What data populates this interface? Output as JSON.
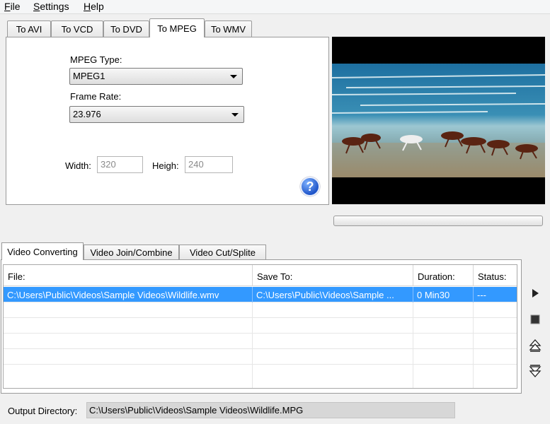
{
  "menu": {
    "items": [
      {
        "label": "File",
        "key": "F",
        "rest": "ile"
      },
      {
        "label": "Settings",
        "key": "S",
        "rest": "ettings"
      },
      {
        "label": "Help",
        "key": "H",
        "rest": "elp"
      }
    ]
  },
  "format_tabs": [
    "To AVI",
    "To  VCD",
    "To DVD",
    "To MPEG",
    "To WMV"
  ],
  "active_format_tab": "To MPEG",
  "mpeg": {
    "type_label": "MPEG Type:",
    "type_value": "MPEG1",
    "frame_rate_label": "Frame Rate:",
    "frame_rate_value": "23.976",
    "width_label": "Width:",
    "width_value": "320",
    "height_label": "Heigh:",
    "height_value": "240"
  },
  "help_icon": "question-icon",
  "preview": {
    "description_icon": "video-preview-image"
  },
  "bottom_tabs": [
    "Video Converting",
    "Video Join/Combine",
    "Video Cut/Splite"
  ],
  "active_bottom_tab": "Video Converting",
  "table": {
    "columns": [
      "File:",
      "Save To:",
      "Duration:",
      "Status:"
    ],
    "rows": [
      {
        "file": "C:\\Users\\Public\\Videos\\Sample Videos\\Wildlife.wmv",
        "save_to": "C:\\Users\\Public\\Videos\\Sample ...",
        "duration": "0  Min30",
        "status": "---"
      }
    ]
  },
  "side_buttons": [
    "play-icon",
    "stop-icon",
    "move-up-icon",
    "move-down-icon"
  ],
  "output": {
    "label": "Output Directory:",
    "value": "C:\\Users\\Public\\Videos\\Sample Videos\\Wildlife.MPG"
  },
  "colors": {
    "selection": "#3399ff",
    "help_blue": "#1f55c9"
  }
}
